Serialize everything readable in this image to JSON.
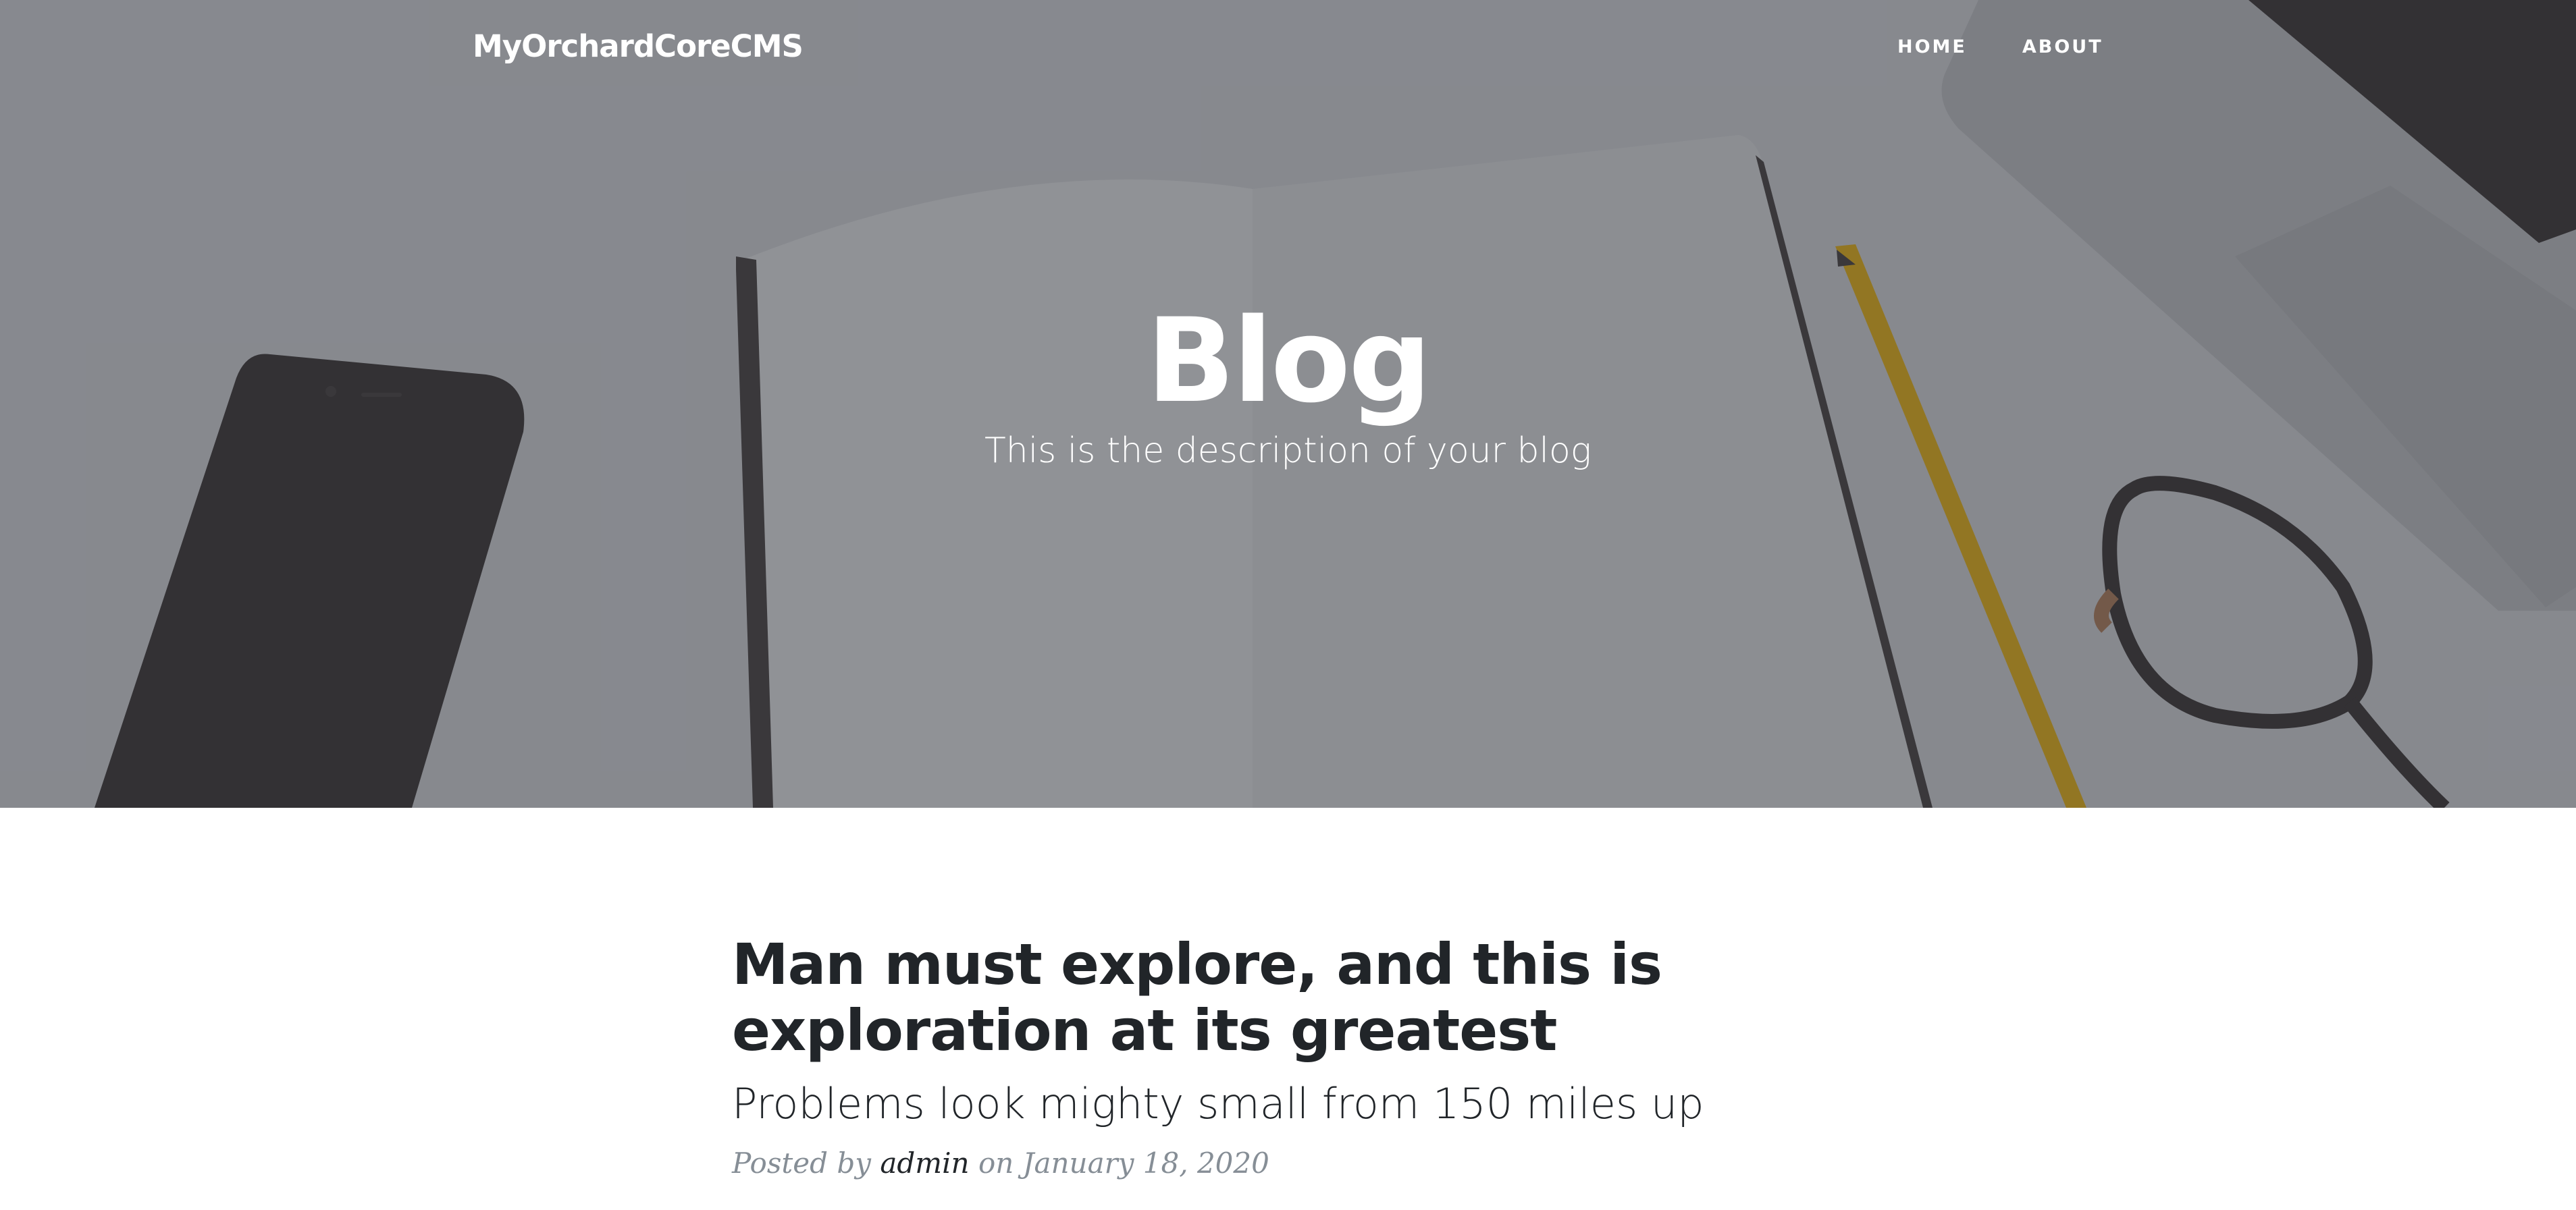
{
  "navbar": {
    "brand": "MyOrchardCoreCMS",
    "links": [
      {
        "label": "HOME"
      },
      {
        "label": "ABOUT"
      }
    ]
  },
  "header": {
    "title": "Blog",
    "subheading": "This is the description of your blog"
  },
  "posts": [
    {
      "title": "Man must explore, and this is exploration at its greatest",
      "subtitle": "Problems look mighty small from 150 miles up",
      "meta_prefix": "Posted by",
      "author": "admin",
      "meta_date": "on January 18, 2020"
    }
  ]
}
